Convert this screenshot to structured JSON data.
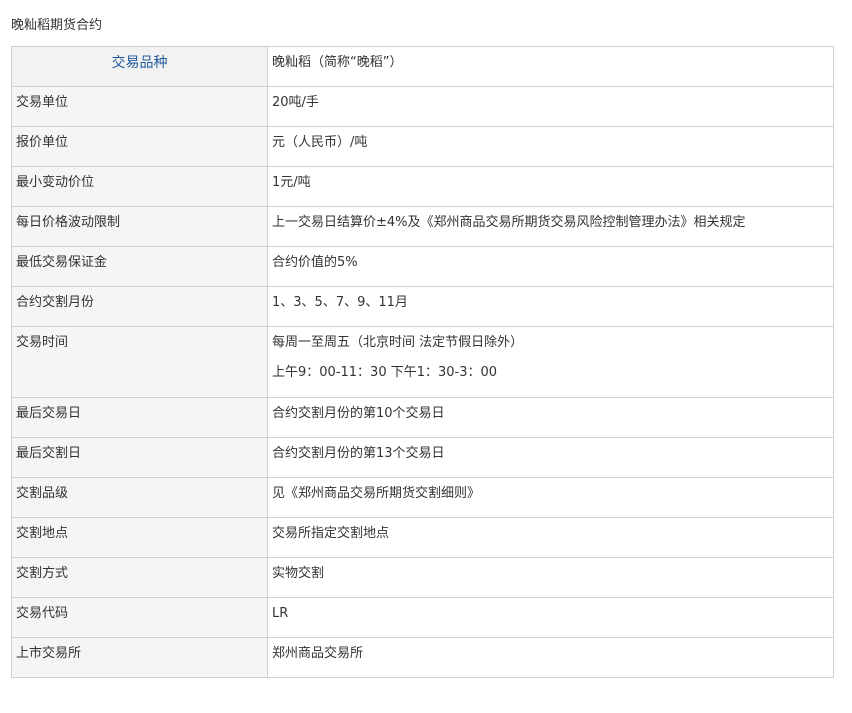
{
  "title": "晚籼稻期货合约",
  "header": {
    "key": "交易品种",
    "value": "晚籼稻（简称“晚稻”）"
  },
  "rows": [
    {
      "key": "交易单位",
      "value": "20吨/手"
    },
    {
      "key": "报价单位",
      "value": "元（人民币）/吨"
    },
    {
      "key": "最小变动价位",
      "value": "1元/吨"
    },
    {
      "key": "每日价格波动限制",
      "value": "上一交易日结算价±4%及《郑州商品交易所期货交易风险控制管理办法》相关规定"
    },
    {
      "key": "最低交易保证金",
      "value": "合约价值的5%"
    },
    {
      "key": "合约交割月份",
      "value": "1、3、5、7、9、11月"
    },
    {
      "key": "交易时间",
      "value": "每周一至周五（北京时间 法定节假日除外）",
      "value2": "上午9：00-11：30 下午1：30-3：00"
    },
    {
      "key": "最后交易日",
      "value": "合约交割月份的第10个交易日"
    },
    {
      "key": "最后交割日",
      "value": "合约交割月份的第13个交易日"
    },
    {
      "key": "交割品级",
      "value": "见《郑州商品交易所期货交割细则》"
    },
    {
      "key": "交割地点",
      "value": "交易所指定交割地点"
    },
    {
      "key": "交割方式",
      "value": "实物交割"
    },
    {
      "key": "交易代码",
      "value": "LR"
    },
    {
      "key": "上市交易所",
      "value": "郑州商品交易所"
    }
  ]
}
